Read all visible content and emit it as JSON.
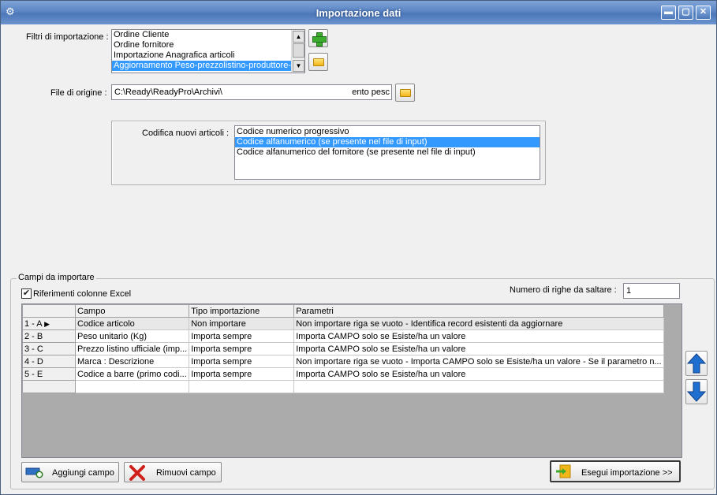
{
  "window": {
    "title": "Importazione dati",
    "controls": {
      "minimize": "▬",
      "maximize": "▢",
      "close": "✕"
    }
  },
  "filters": {
    "label": "Filtri di importazione :",
    "items": [
      "Ordine Cliente",
      "Ordine fornitore",
      "Importazione Anagrafica articoli",
      "Aggiornamento Peso-prezzolistino-produttore-"
    ],
    "selected_index": 3,
    "add_icon": "plus-icon",
    "open_icon": "folder-icon"
  },
  "file": {
    "label": "File di origine :",
    "value_start": "C:\\Ready\\ReadyPro\\Archivi\\",
    "value_end": "ento pesc",
    "browse_icon": "folder-icon"
  },
  "codifica": {
    "label": "Codifica nuovi articoli :",
    "items": [
      "Codice numerico progressivo",
      "Codice alfanumerico (se presente nel file di input)",
      "Codice alfanumerico del fornitore (se presente nel file di input)"
    ],
    "selected_index": 1
  },
  "campi": {
    "group_title": "Campi da importare",
    "excel_refs_label": "Riferimenti colonne Excel",
    "excel_refs_checked": true,
    "skip_rows_label": "Numero di righe da saltare  :",
    "skip_rows_value": "1",
    "columns": [
      "Campo",
      "Tipo importazione",
      "Parametri"
    ],
    "rows": [
      {
        "ref": "1 - A",
        "campo": "Codice articolo",
        "tipo": "Non importare",
        "parametri": "Non importare riga se vuoto - Identifica record esistenti da aggiornare",
        "current": true
      },
      {
        "ref": "2 - B",
        "campo": "Peso unitario (Kg)",
        "tipo": "Importa sempre",
        "parametri": "Importa CAMPO solo se Esiste/ha un valore"
      },
      {
        "ref": "3 - C",
        "campo": "Prezzo listino ufficiale (imp...",
        "tipo": "Importa sempre",
        "parametri": "Importa CAMPO solo se Esiste/ha un valore"
      },
      {
        "ref": "4 - D",
        "campo": "Marca : Descrizione",
        "tipo": "Importa sempre",
        "parametri": "Non importare riga se vuoto - Importa CAMPO solo se Esiste/ha un valore  - Se il parametro n..."
      },
      {
        "ref": "5 - E",
        "campo": "Codice a barre (primo codi...",
        "tipo": "Importa sempre",
        "parametri": "Importa CAMPO solo se Esiste/ha un valore"
      }
    ],
    "move_up_icon": "arrow-up-icon",
    "move_down_icon": "arrow-down-icon"
  },
  "actions": {
    "add_field": "Aggiungi campo",
    "remove_field": "Rimuovi campo",
    "run_import": "Esegui importazione >>"
  },
  "colors": {
    "title_bar": "#5b85c4",
    "selection": "#3399ff",
    "arrow_blue": "#1f6fd0",
    "remove_red": "#d0201a",
    "grid_background": "#ababab"
  }
}
